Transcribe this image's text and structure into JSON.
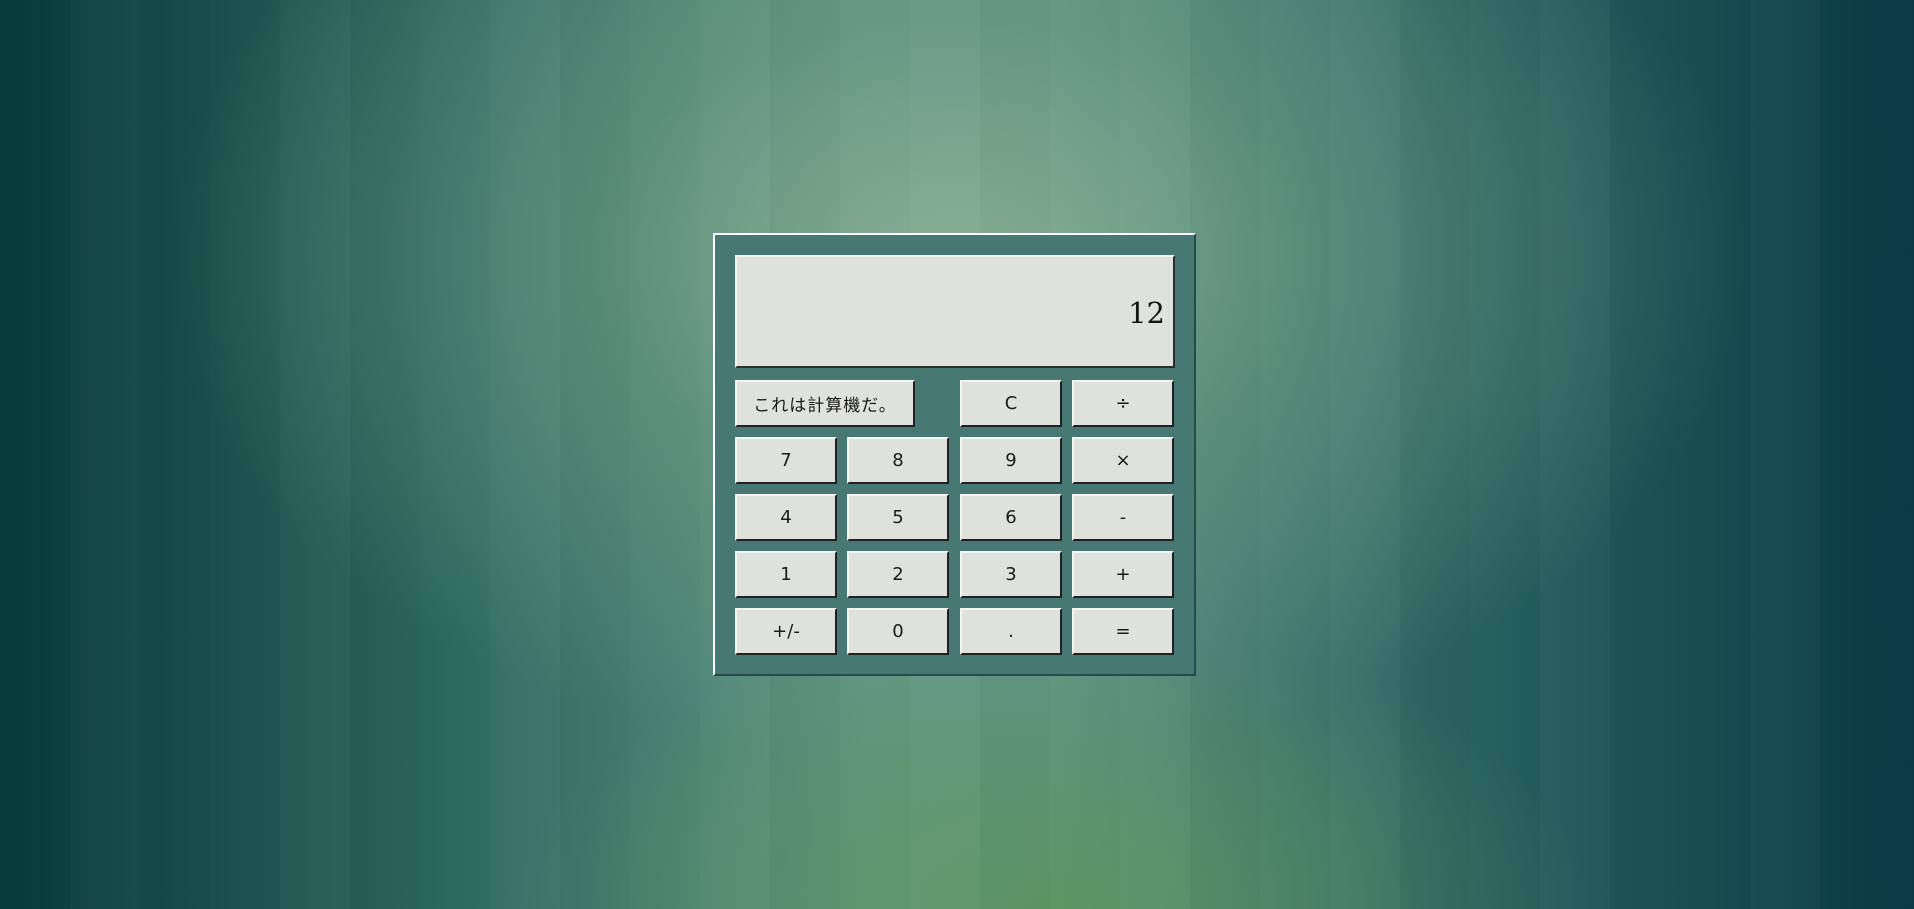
{
  "display": {
    "value": "12"
  },
  "buttons": {
    "about": "これは計算機だ。",
    "clear": "C",
    "divide": "÷",
    "seven": "7",
    "eight": "8",
    "nine": "9",
    "multiply": "×",
    "four": "4",
    "five": "5",
    "six": "6",
    "subtract": "-",
    "one": "1",
    "two": "2",
    "three": "3",
    "add": "+",
    "negate": "+/-",
    "zero": "0",
    "decimal": ".",
    "equals": "="
  },
  "colors": {
    "panel": "#487874",
    "key_face": "#dfe2dc"
  }
}
